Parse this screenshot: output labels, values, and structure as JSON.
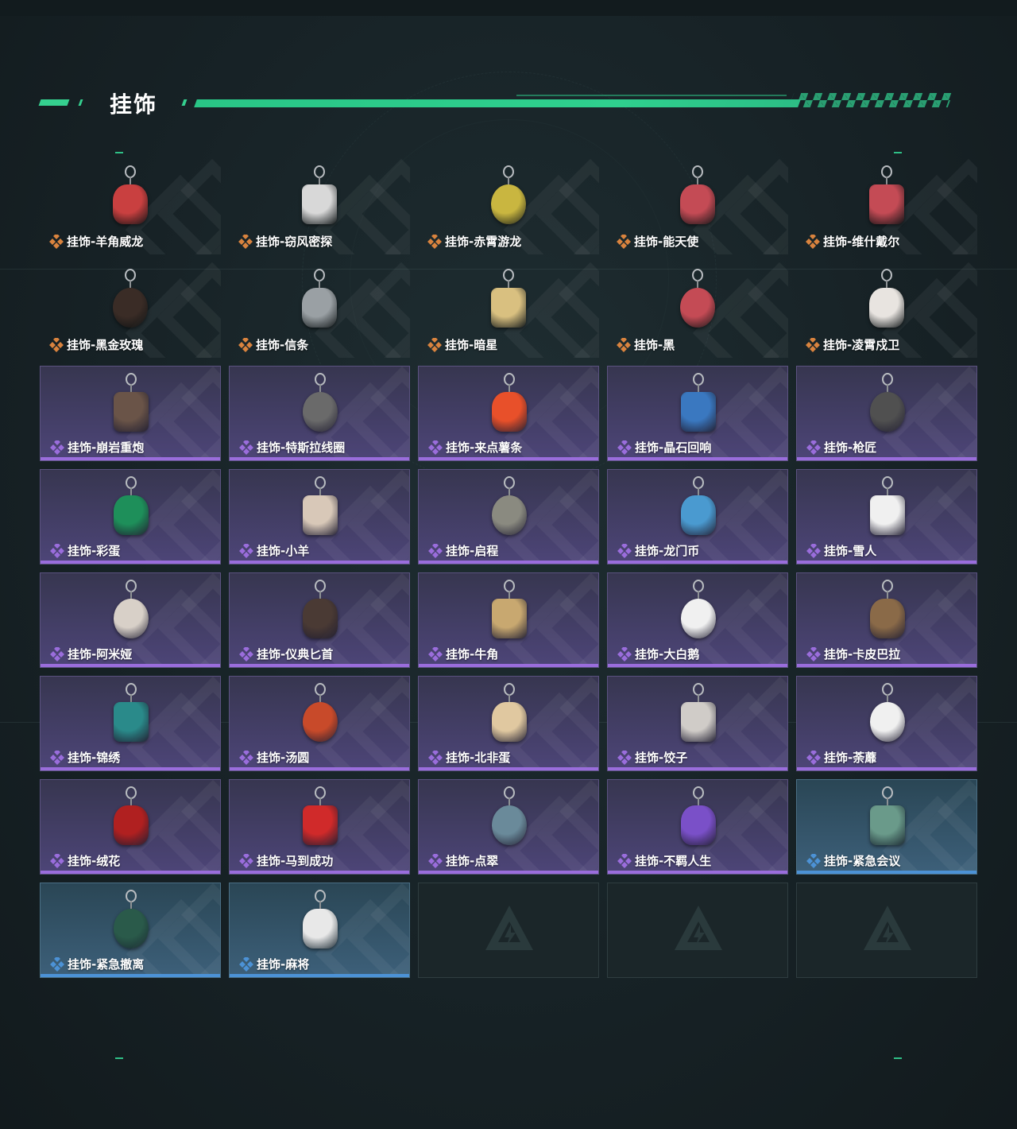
{
  "section": {
    "title": "挂饰"
  },
  "colors": {
    "accent": "#35d08f",
    "legendary_bar": "#d9833e",
    "epic_bar": "#9a6ddc",
    "rare_bar": "#4c92d6"
  },
  "items": [
    {
      "name": "挂饰-羊角威龙",
      "rarity": "legendary",
      "icon": "dragon-charm-icon"
    },
    {
      "name": "挂饰-窃风密探",
      "rarity": "legendary",
      "icon": "rabbit-agent-charm-icon"
    },
    {
      "name": "挂饰-赤霄游龙",
      "rarity": "legendary",
      "icon": "yellow-figure-charm-icon"
    },
    {
      "name": "挂饰-能天使",
      "rarity": "legendary",
      "icon": "card-charm-icon"
    },
    {
      "name": "挂饰-维什戴尔",
      "rarity": "legendary",
      "icon": "card-charm-icon"
    },
    {
      "name": "挂饰-黑金玫瑰",
      "rarity": "legendary",
      "icon": "black-gold-rose-charm-icon"
    },
    {
      "name": "挂饰-信条",
      "rarity": "legendary",
      "icon": "silver-figure-charm-icon"
    },
    {
      "name": "挂饰-暗星",
      "rarity": "legendary",
      "icon": "bird-charm-icon"
    },
    {
      "name": "挂饰-黑",
      "rarity": "legendary",
      "icon": "card-charm-icon"
    },
    {
      "name": "挂饰-凌霄戍卫",
      "rarity": "legendary",
      "icon": "rocket-charm-icon"
    },
    {
      "name": "挂饰-崩岩重炮",
      "rarity": "epic",
      "icon": "figure-charm-icon"
    },
    {
      "name": "挂饰-特斯拉线圈",
      "rarity": "epic",
      "icon": "tesla-coil-charm-icon"
    },
    {
      "name": "挂饰-来点薯条",
      "rarity": "epic",
      "icon": "fries-charm-icon"
    },
    {
      "name": "挂饰-晶石回响",
      "rarity": "epic",
      "icon": "crystal-charm-icon"
    },
    {
      "name": "挂饰-枪匠",
      "rarity": "epic",
      "icon": "gun-part-charm-icon"
    },
    {
      "name": "挂饰-彩蛋",
      "rarity": "epic",
      "icon": "green-egg-charm-icon"
    },
    {
      "name": "挂饰-小羊",
      "rarity": "epic",
      "icon": "sheep-charm-icon"
    },
    {
      "name": "挂饰-启程",
      "rarity": "epic",
      "icon": "emblem-charm-icon"
    },
    {
      "name": "挂饰-龙门币",
      "rarity": "epic",
      "icon": "coin-charm-icon"
    },
    {
      "name": "挂饰-雪人",
      "rarity": "epic",
      "icon": "snowman-charm-icon"
    },
    {
      "name": "挂饰-阿米娅",
      "rarity": "epic",
      "icon": "bunny-charm-icon"
    },
    {
      "name": "挂饰-仪典匕首",
      "rarity": "epic",
      "icon": "dagger-charm-icon"
    },
    {
      "name": "挂饰-牛角",
      "rarity": "epic",
      "icon": "horns-charm-icon"
    },
    {
      "name": "挂饰-大白鹅",
      "rarity": "epic",
      "icon": "goose-charm-icon"
    },
    {
      "name": "挂饰-卡皮巴拉",
      "rarity": "epic",
      "icon": "capybara-charm-icon"
    },
    {
      "name": "挂饰-锦绣",
      "rarity": "epic",
      "icon": "butterfly-charm-icon"
    },
    {
      "name": "挂饰-汤圆",
      "rarity": "epic",
      "icon": "tangyuan-charm-icon"
    },
    {
      "name": "挂饰-北非蛋",
      "rarity": "epic",
      "icon": "shakshuka-charm-icon"
    },
    {
      "name": "挂饰-饺子",
      "rarity": "epic",
      "icon": "dumpling-charm-icon"
    },
    {
      "name": "挂饰-荼蘼",
      "rarity": "epic",
      "icon": "flower-figure-charm-icon"
    },
    {
      "name": "挂饰-绒花",
      "rarity": "epic",
      "icon": "rose-charm-icon"
    },
    {
      "name": "挂饰-马到成功",
      "rarity": "epic",
      "icon": "horse-charm-icon"
    },
    {
      "name": "挂饰-点翠",
      "rarity": "epic",
      "icon": "hairpin-charm-icon"
    },
    {
      "name": "挂饰-不羁人生",
      "rarity": "epic",
      "icon": "sneaker-charm-icon"
    },
    {
      "name": "挂饰-紧急会议",
      "rarity": "rare",
      "icon": "meeting-charm-icon"
    },
    {
      "name": "挂饰-紧急撤离",
      "rarity": "rare",
      "icon": "green-cube-charm-icon"
    },
    {
      "name": "挂饰-麻将",
      "rarity": "rare",
      "icon": "mahjong-charm-icon"
    }
  ],
  "empty_slots": 3
}
